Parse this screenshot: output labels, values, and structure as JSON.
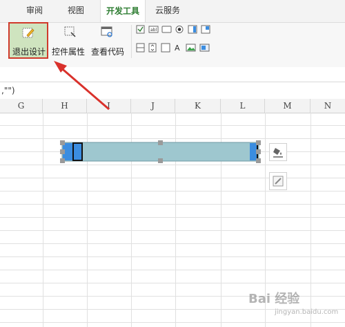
{
  "ribbon_tabs": [
    {
      "label": "审阅"
    },
    {
      "label": "视图"
    },
    {
      "label": "开发工具",
      "active": true
    },
    {
      "label": "云服务"
    }
  ],
  "ribbon_buttons": {
    "exit_design": "退出设计",
    "control_properties": "控件属性",
    "view_code": "查看代码"
  },
  "formula_bar": {
    "text": ",\"\")"
  },
  "columns": [
    "G",
    "H",
    "I",
    "J",
    "K",
    "L",
    "M",
    "N"
  ],
  "colors": {
    "active_tab_text": "#2e7d32",
    "highlight_border": "#d0392b",
    "scroll_track": "#9ec7cf",
    "scroll_button": "#3b8de0"
  },
  "watermark": {
    "text": "Bai 经验",
    "sub": "jingyan.baidu.com"
  }
}
